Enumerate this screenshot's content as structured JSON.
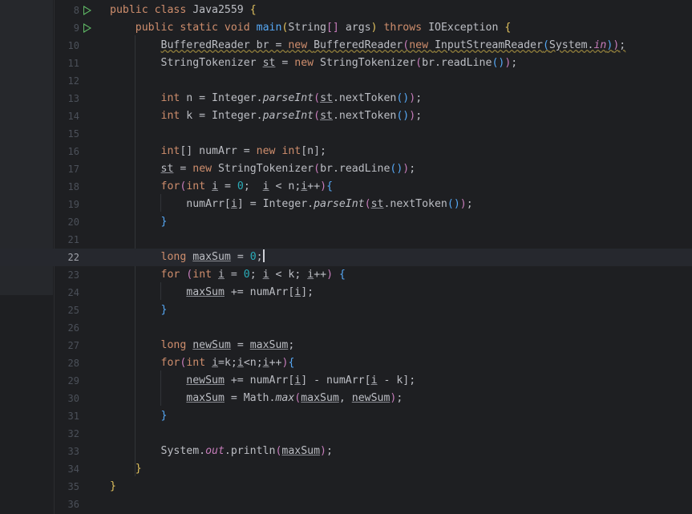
{
  "editor": {
    "current_line": 22,
    "lines": [
      {
        "n": "8",
        "run": true,
        "tokens": [
          [
            "kw",
            "public class "
          ],
          [
            "t",
            "Java2559 "
          ],
          [
            "p1",
            "{"
          ]
        ]
      },
      {
        "n": "9",
        "run": true,
        "tokens": [
          [
            "t",
            "    "
          ],
          [
            "kw",
            "public static void "
          ],
          [
            "fn",
            "main"
          ],
          [
            "p1",
            "("
          ],
          [
            "t",
            "String"
          ],
          [
            "p2",
            "[]"
          ],
          [
            "t",
            " args"
          ],
          [
            "p1",
            ")"
          ],
          [
            "kw",
            " throws "
          ],
          [
            "t",
            "IOException "
          ],
          [
            "p1",
            "{"
          ]
        ]
      },
      {
        "n": "10",
        "tokens": [
          [
            "t",
            "        "
          ],
          [
            "w",
            "BufferedReader br = "
          ],
          [
            "kwW",
            "new "
          ],
          [
            "w",
            "BufferedReader"
          ],
          [
            "p2W",
            "("
          ],
          [
            "kwW",
            "new "
          ],
          [
            "w",
            "InputStreamReader"
          ],
          [
            "p3W",
            "("
          ],
          [
            "w",
            "System."
          ],
          [
            "stW",
            "in"
          ],
          [
            "p3W",
            ")"
          ],
          [
            "p2W",
            ")"
          ],
          [
            "w",
            ";"
          ]
        ]
      },
      {
        "n": "11",
        "tokens": [
          [
            "t",
            "        StringTokenizer "
          ],
          [
            "ul",
            "st"
          ],
          [
            "t",
            " = "
          ],
          [
            "kw",
            "new "
          ],
          [
            "t",
            "StringTokenizer"
          ],
          [
            "p2",
            "("
          ],
          [
            "t",
            "br.readLine"
          ],
          [
            "p3",
            "()"
          ],
          [
            "p2",
            ")"
          ],
          [
            "t",
            ";"
          ]
        ]
      },
      {
        "n": "12",
        "tokens": []
      },
      {
        "n": "13",
        "tokens": [
          [
            "t",
            "        "
          ],
          [
            "kw",
            "int "
          ],
          [
            "t",
            "n = Integer."
          ],
          [
            "it",
            "parseInt"
          ],
          [
            "p2",
            "("
          ],
          [
            "ul",
            "st"
          ],
          [
            "t",
            ".nextToken"
          ],
          [
            "p3",
            "()"
          ],
          [
            "p2",
            ")"
          ],
          [
            "t",
            ";"
          ]
        ]
      },
      {
        "n": "14",
        "tokens": [
          [
            "t",
            "        "
          ],
          [
            "kw",
            "int "
          ],
          [
            "t",
            "k = Integer."
          ],
          [
            "it",
            "parseInt"
          ],
          [
            "p2",
            "("
          ],
          [
            "ul",
            "st"
          ],
          [
            "t",
            ".nextToken"
          ],
          [
            "p3",
            "()"
          ],
          [
            "p2",
            ")"
          ],
          [
            "t",
            ";"
          ]
        ]
      },
      {
        "n": "15",
        "tokens": []
      },
      {
        "n": "16",
        "tokens": [
          [
            "t",
            "        "
          ],
          [
            "kw",
            "int"
          ],
          [
            "t",
            "[] numArr = "
          ],
          [
            "kw",
            "new int"
          ],
          [
            "t",
            "[n];"
          ]
        ]
      },
      {
        "n": "17",
        "tokens": [
          [
            "t",
            "        "
          ],
          [
            "ul",
            "st"
          ],
          [
            "t",
            " = "
          ],
          [
            "kw",
            "new "
          ],
          [
            "t",
            "StringTokenizer"
          ],
          [
            "p2",
            "("
          ],
          [
            "t",
            "br.readLine"
          ],
          [
            "p3",
            "()"
          ],
          [
            "p2",
            ")"
          ],
          [
            "t",
            ";"
          ]
        ]
      },
      {
        "n": "18",
        "tokens": [
          [
            "t",
            "        "
          ],
          [
            "kw",
            "for"
          ],
          [
            "p2",
            "("
          ],
          [
            "kw",
            "int "
          ],
          [
            "ul",
            "i"
          ],
          [
            "t",
            " = "
          ],
          [
            "num",
            "0"
          ],
          [
            "t",
            ";  "
          ],
          [
            "ul",
            "i"
          ],
          [
            "t",
            " < n;"
          ],
          [
            "ul",
            "i"
          ],
          [
            "t",
            "++"
          ],
          [
            "p2",
            ")"
          ],
          [
            "p3",
            "{"
          ]
        ]
      },
      {
        "n": "19",
        "tokens": [
          [
            "t",
            "            numArr["
          ],
          [
            "ul",
            "i"
          ],
          [
            "t",
            "] = Integer."
          ],
          [
            "it",
            "parseInt"
          ],
          [
            "p2",
            "("
          ],
          [
            "ul",
            "st"
          ],
          [
            "t",
            ".nextToken"
          ],
          [
            "p3",
            "()"
          ],
          [
            "p2",
            ")"
          ],
          [
            "t",
            ";"
          ]
        ]
      },
      {
        "n": "20",
        "tokens": [
          [
            "t",
            "        "
          ],
          [
            "p3",
            "}"
          ]
        ]
      },
      {
        "n": "21",
        "tokens": []
      },
      {
        "n": "22",
        "tokens": [
          [
            "t",
            "        "
          ],
          [
            "kw",
            "long "
          ],
          [
            "ul",
            "maxSum"
          ],
          [
            "t",
            " = "
          ],
          [
            "num",
            "0"
          ],
          [
            "t",
            ";"
          ],
          [
            "caret",
            ""
          ]
        ]
      },
      {
        "n": "23",
        "tokens": [
          [
            "t",
            "        "
          ],
          [
            "kw",
            "for "
          ],
          [
            "p2",
            "("
          ],
          [
            "kw",
            "int "
          ],
          [
            "ul",
            "i"
          ],
          [
            "t",
            " = "
          ],
          [
            "num",
            "0"
          ],
          [
            "t",
            "; "
          ],
          [
            "ul",
            "i"
          ],
          [
            "t",
            " < k; "
          ],
          [
            "ul",
            "i"
          ],
          [
            "t",
            "++"
          ],
          [
            "p2",
            ")"
          ],
          [
            "t",
            " "
          ],
          [
            "p3",
            "{"
          ]
        ]
      },
      {
        "n": "24",
        "tokens": [
          [
            "t",
            "            "
          ],
          [
            "ul",
            "maxSum"
          ],
          [
            "t",
            " += numArr["
          ],
          [
            "ul",
            "i"
          ],
          [
            "t",
            "];"
          ]
        ]
      },
      {
        "n": "25",
        "tokens": [
          [
            "t",
            "        "
          ],
          [
            "p3",
            "}"
          ]
        ]
      },
      {
        "n": "26",
        "tokens": []
      },
      {
        "n": "27",
        "tokens": [
          [
            "t",
            "        "
          ],
          [
            "kw",
            "long "
          ],
          [
            "ul",
            "newSum"
          ],
          [
            "t",
            " = "
          ],
          [
            "ul",
            "maxSum"
          ],
          [
            "t",
            ";"
          ]
        ]
      },
      {
        "n": "28",
        "tokens": [
          [
            "t",
            "        "
          ],
          [
            "kw",
            "for"
          ],
          [
            "p2",
            "("
          ],
          [
            "kw",
            "int "
          ],
          [
            "ul",
            "i"
          ],
          [
            "t",
            "=k;"
          ],
          [
            "ul",
            "i"
          ],
          [
            "t",
            "<n;"
          ],
          [
            "ul",
            "i"
          ],
          [
            "t",
            "++"
          ],
          [
            "p2",
            ")"
          ],
          [
            "p3",
            "{"
          ]
        ]
      },
      {
        "n": "29",
        "tokens": [
          [
            "t",
            "            "
          ],
          [
            "ul",
            "newSum"
          ],
          [
            "t",
            " += numArr["
          ],
          [
            "ul",
            "i"
          ],
          [
            "t",
            "] - numArr["
          ],
          [
            "ul",
            "i"
          ],
          [
            "t",
            " - k];"
          ]
        ]
      },
      {
        "n": "30",
        "tokens": [
          [
            "t",
            "            "
          ],
          [
            "ul",
            "maxSum"
          ],
          [
            "t",
            " = Math."
          ],
          [
            "it",
            "max"
          ],
          [
            "p2",
            "("
          ],
          [
            "ul",
            "maxSum"
          ],
          [
            "t",
            ", "
          ],
          [
            "ul",
            "newSum"
          ],
          [
            "p2",
            ")"
          ],
          [
            "t",
            ";"
          ]
        ]
      },
      {
        "n": "31",
        "tokens": [
          [
            "t",
            "        "
          ],
          [
            "p3",
            "}"
          ]
        ]
      },
      {
        "n": "32",
        "tokens": []
      },
      {
        "n": "33",
        "tokens": [
          [
            "t",
            "        System."
          ],
          [
            "st",
            "out"
          ],
          [
            "t",
            ".println"
          ],
          [
            "p2",
            "("
          ],
          [
            "ul",
            "maxSum"
          ],
          [
            "p2",
            ")"
          ],
          [
            "t",
            ";"
          ]
        ]
      },
      {
        "n": "34",
        "tokens": [
          [
            "t",
            "    "
          ],
          [
            "p1",
            "}"
          ]
        ]
      },
      {
        "n": "35",
        "tokens": [
          [
            "p1",
            "}"
          ]
        ]
      },
      {
        "n": "36",
        "tokens": []
      }
    ]
  },
  "colors": {
    "background": "#1e1f22",
    "keyword": "#cf8e6d",
    "function": "#56a8f5",
    "number": "#2aacb8",
    "static_field": "#c77dbb",
    "run_icon": "#5fb865"
  }
}
